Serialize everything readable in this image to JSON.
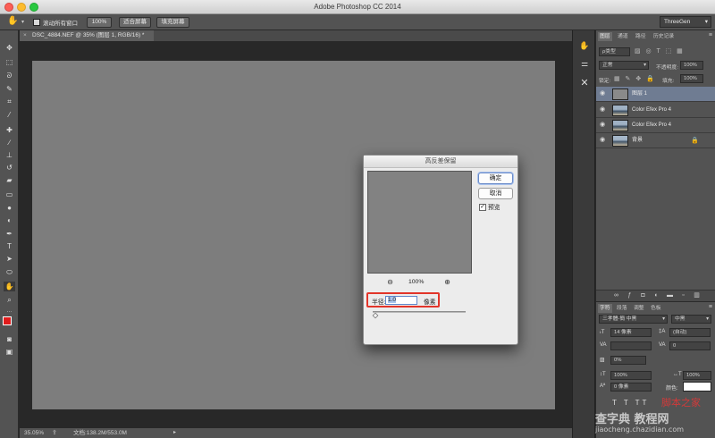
{
  "window": {
    "title": "Adobe Photoshop CC 2014"
  },
  "options": {
    "checkbox_label": "滚动所有窗口",
    "btn_100": "100%",
    "btn_fit": "适合屏幕",
    "btn_fill": "填充屏幕",
    "workspace": "ThreeGen"
  },
  "document": {
    "tab_title": "DSC_4884.NEF @ 35% (图层 1, RGB/16) *",
    "zoom": "35.05%",
    "doc_info": "文档:138.2M/553.0M"
  },
  "layers_panel": {
    "tabs": [
      "图层",
      "通道",
      "路径",
      "历史记录"
    ],
    "filter": "ρ类型",
    "blend_mode": "正常",
    "opacity_label": "不透明度:",
    "opacity_value": "100%",
    "lock_label": "锁定:",
    "fill_label": "填充:",
    "fill_value": "100%",
    "layers": [
      {
        "name": "图层 1",
        "selected": true
      },
      {
        "name": "Color Efex Pro 4",
        "selected": false
      },
      {
        "name": "Color Efex Pro 4",
        "selected": false
      },
      {
        "name": "背景",
        "selected": false
      }
    ]
  },
  "char_panel": {
    "tabs": [
      "字符",
      "段落",
      "调整",
      "色板"
    ],
    "font_family": "三孝體-簡 中黑",
    "font_style": "中黑",
    "font_size": "14 像素",
    "leading": "(自动)",
    "kerning": "",
    "tracking": "0",
    "scale_pct": "0%",
    "vscale": "100%",
    "hscale": "100%",
    "baseline": "0 像素",
    "color_label": "颜色:"
  },
  "dialog": {
    "title": "高反差保留",
    "ok": "确定",
    "cancel": "取消",
    "preview_label": "预览",
    "preview_checked": true,
    "zoom": "100%",
    "radius_label": "半径:",
    "radius_value": "1.0",
    "radius_unit": "像素"
  },
  "watermark": {
    "line1": "脚本之家",
    "line2": "查字典 教程网",
    "line3": "jiaocheng.chazidian.com"
  }
}
